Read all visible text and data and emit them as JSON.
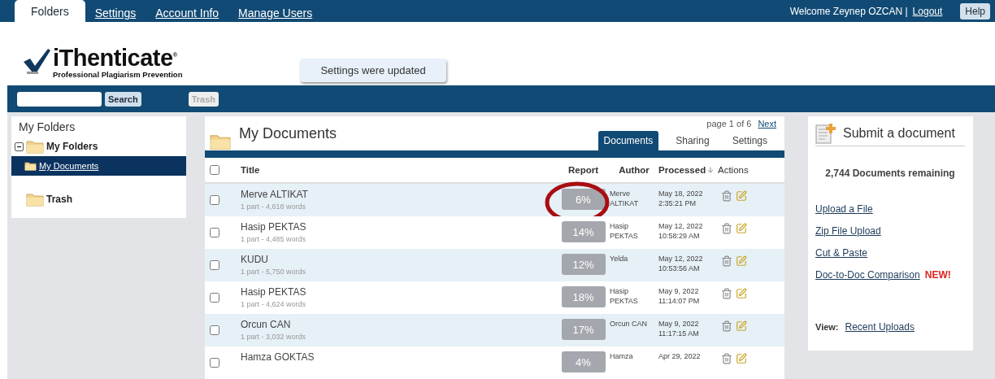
{
  "top_nav": {
    "tabs": [
      {
        "label": "Folders",
        "selected": true
      },
      {
        "label": "Settings",
        "selected": false
      },
      {
        "label": "Account Info",
        "selected": false
      },
      {
        "label": "Manage Users",
        "selected": false
      }
    ],
    "welcome": "Welcome Zeynep OZCAN |",
    "logout": "Logout",
    "help": "Help"
  },
  "logo": {
    "name": "iThenticate",
    "mark": "®",
    "tagline": "Professional Plagiarism Prevention"
  },
  "notice": "Settings were updated",
  "toolbar": {
    "search_button": "Search",
    "trash_button": {
      "label": "Trash",
      "disabled": true
    }
  },
  "sidebar": {
    "title": "My Folders",
    "items": [
      {
        "label": "My Folders",
        "expanded": true,
        "selected": false,
        "children": [
          {
            "label": "My Documents",
            "selected": true
          }
        ]
      },
      {
        "label": "Trash",
        "selected": false
      }
    ]
  },
  "documents": {
    "title": "My Documents",
    "pagination": "page 1 of 6",
    "next": "Next",
    "tabs": [
      {
        "label": "Documents",
        "selected": true
      },
      {
        "label": "Sharing",
        "selected": false
      },
      {
        "label": "Settings",
        "selected": false
      }
    ],
    "columns": [
      {
        "label": "Title",
        "sorted": false
      },
      {
        "label": "Report",
        "sorted": false
      },
      {
        "label": "Author",
        "sorted": false
      },
      {
        "label": "Processed",
        "sorted": true
      },
      {
        "label": "Actions",
        "sorted": false
      }
    ],
    "select_all": {
      "checked": false
    },
    "rows": [
      {
        "title": "Merve ALTIKAT",
        "meta": "1 part - 4,618 words",
        "report": "6%",
        "author": "Merve ALTIKAT",
        "date": "May 18, 2022",
        "time": "2:35:21 PM",
        "checked": false,
        "circled": true
      },
      {
        "title": "Hasip PEKTAS",
        "meta": "1 part - 4,485 words",
        "report": "14%",
        "author": "Hasip PEKTAS",
        "date": "May 12, 2022",
        "time": "10:58:29 AM",
        "checked": false,
        "circled": false
      },
      {
        "title": "KUDU",
        "meta": "1 part - 5,750 words",
        "report": "12%",
        "author": "Yelda",
        "date": "May 12, 2022",
        "time": "10:53:56 AM",
        "checked": false,
        "circled": false
      },
      {
        "title": "Hasip PEKTAS",
        "meta": "1 part - 4,624 words",
        "report": "18%",
        "author": "Hasip PEKTAS",
        "date": "May 9, 2022",
        "time": "11:14:07 PM",
        "checked": false,
        "circled": false
      },
      {
        "title": "Orcun CAN",
        "meta": "1 part - 3,032 words",
        "report": "17%",
        "author": "Orcun CAN",
        "date": "May 9, 2022",
        "time": "11:17:15 AM",
        "checked": false,
        "circled": false
      },
      {
        "title": "Hamza GOKTAS",
        "report": "4%",
        "author": "Hamza",
        "date": "Apr 29, 2022",
        "checked": false,
        "circled": false
      }
    ]
  },
  "submit": {
    "title": "Submit a document",
    "remaining": "2,744 Documents remaining",
    "links": [
      {
        "label": "Upload a File"
      },
      {
        "label": "Zip File Upload"
      },
      {
        "label": "Cut & Paste"
      },
      {
        "label": "Doc-to-Doc Comparison",
        "badge": "NEW!"
      }
    ],
    "view_label": "View:",
    "view_link": "Recent Uploads"
  }
}
